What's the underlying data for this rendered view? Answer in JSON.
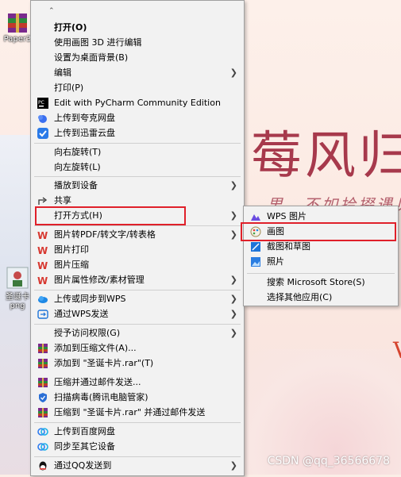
{
  "desktop": {
    "icon1_label": "Paper3",
    "icon2_label": "圣诞卡",
    "icon2_label2": "png",
    "deco_title": "莓风归",
    "deco_sub": "，男，不如拾掇遇见",
    "watermark": "CSDN @qq_36566678"
  },
  "main_menu": {
    "items": [
      {
        "label": "打开(O)"
      },
      {
        "label": "使用画图 3D 进行编辑"
      },
      {
        "label": "设置为桌面背景(B)"
      },
      {
        "label": "编辑"
      },
      {
        "label": "打印(P)"
      },
      {
        "label": "Edit with PyCharm Community Edition"
      },
      {
        "label": "上传到夸克网盘"
      },
      {
        "label": "上传到迅雷云盘"
      },
      {
        "label": "向右旋转(T)"
      },
      {
        "label": "向左旋转(L)"
      },
      {
        "label": "播放到设备"
      },
      {
        "label": "共享"
      },
      {
        "label": "打开方式(H)"
      },
      {
        "label": "图片转PDF/转文字/转表格"
      },
      {
        "label": "图片打印"
      },
      {
        "label": "图片压缩"
      },
      {
        "label": "图片属性修改/素材管理"
      },
      {
        "label": "上传或同步到WPS"
      },
      {
        "label": "通过WPS发送"
      },
      {
        "label": "授予访问权限(G)"
      },
      {
        "label": "添加到压缩文件(A)..."
      },
      {
        "label": "添加到 \"圣诞卡片.rar\"(T)"
      },
      {
        "label": "压缩并通过邮件发送..."
      },
      {
        "label": "扫描病毒(腾讯电脑管家)"
      },
      {
        "label": "压缩到 \"圣诞卡片.rar\" 并通过邮件发送"
      },
      {
        "label": "上传到百度网盘"
      },
      {
        "label": "同步至其它设备"
      },
      {
        "label": "通过QQ发送到"
      }
    ]
  },
  "sub_menu": {
    "items": [
      {
        "label": "WPS 图片"
      },
      {
        "label": "画图"
      },
      {
        "label": "截图和草图"
      },
      {
        "label": "照片"
      },
      {
        "label": "搜索 Microsoft Store(S)"
      },
      {
        "label": "选择其他应用(C)"
      }
    ]
  },
  "colors": {
    "menu_bg": "#f2f2f2",
    "highlight": "#e0202a",
    "wps_red": "#d7372f",
    "accent_blue": "#1e74d8"
  }
}
